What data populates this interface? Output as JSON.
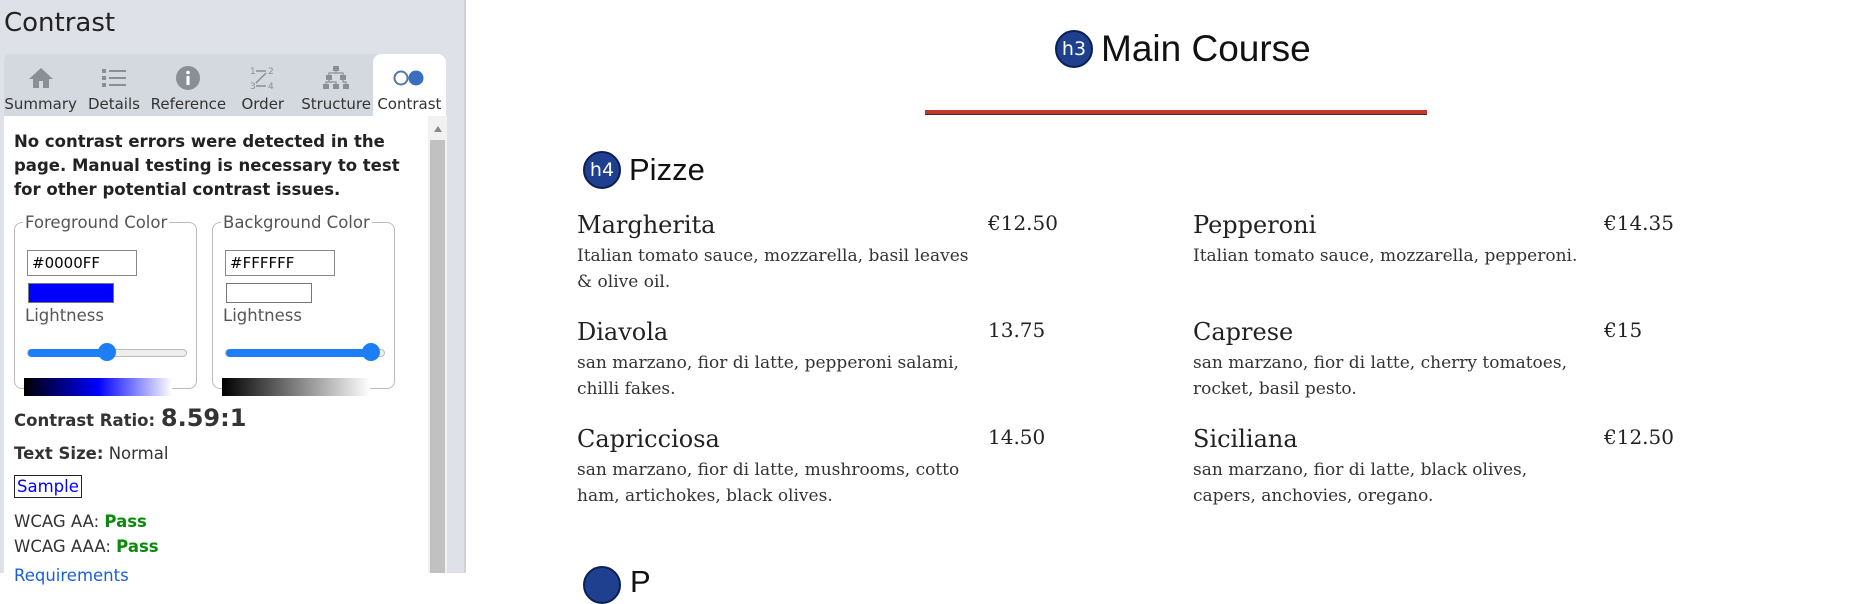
{
  "panel": {
    "title": "Contrast",
    "tabs": [
      {
        "label": "Summary",
        "icon": "home-icon"
      },
      {
        "label": "Details",
        "icon": "list-icon"
      },
      {
        "label": "Reference",
        "icon": "info-icon"
      },
      {
        "label": "Order",
        "icon": "order-icon"
      },
      {
        "label": "Structure",
        "icon": "structure-icon"
      },
      {
        "label": "Contrast",
        "icon": "contrast-icon"
      }
    ],
    "active_tab": "Contrast",
    "notice": "No contrast errors were detected in the page. Manual testing is necessary to test for other potential contrast issues.",
    "foreground": {
      "legend": "Foreground Color",
      "hex": "#0000FF",
      "lightness_label": "Lightness",
      "lightness": 0.5
    },
    "background": {
      "legend": "Background Color",
      "hex": "#FFFFFF",
      "lightness_label": "Lightness",
      "lightness": 0.92
    },
    "ratio_label": "Contrast Ratio:",
    "ratio_value": "8.59:1",
    "text_size_label": "Text Size:",
    "text_size_value": "Normal",
    "sample": "Sample",
    "wcag_aa_label": "WCAG AA:",
    "wcag_aa_value": "Pass",
    "wcag_aaa_label": "WCAG AAA:",
    "wcag_aaa_value": "Pass",
    "more_link": "Requirements"
  },
  "page": {
    "main_heading": {
      "badge": "h3",
      "title": "Main Course"
    },
    "section": {
      "badge": "h4",
      "title": "Pizze"
    },
    "items": [
      {
        "name": "Margherita",
        "price": "€12.50",
        "desc": "Italian tomato sauce, mozzarella, basil leaves & olive oil."
      },
      {
        "name": "Pepperoni",
        "price": "€14.35",
        "desc": "Italian tomato sauce, mozzarella, pepperoni."
      },
      {
        "name": "Diavola",
        "price": "13.75",
        "desc": "san marzano, fior di latte, pepperoni salami, chilli fakes."
      },
      {
        "name": "Caprese",
        "price": "€15",
        "desc": "san marzano, fior di latte, cherry tomatoes, rocket, basil pesto."
      },
      {
        "name": "Capricciosa",
        "price": "14.50",
        "desc": "san marzano, fior di latte, mushrooms, cotto ham, artichokes, black olives."
      },
      {
        "name": "Siciliana",
        "price": "€12.50",
        "desc": "san marzano, fior di latte, black olives, capers, anchovies, oregano."
      }
    ],
    "next_section": {
      "title": "P"
    }
  },
  "colors": {
    "accent": "#1e7ef8",
    "badge": "#1f3f8f",
    "rule": "#c0392b",
    "pass": "#0a8a0a"
  }
}
